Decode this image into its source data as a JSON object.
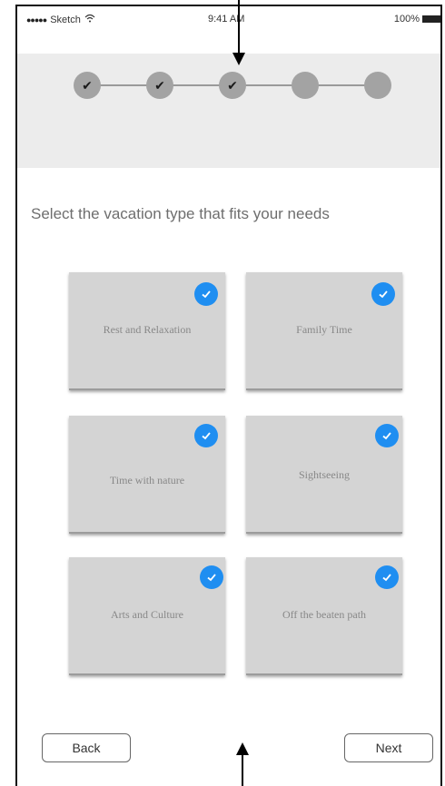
{
  "status_bar": {
    "carrier": "Sketch",
    "signal": "●●●●●",
    "time": "9:41 AM",
    "battery": "100%"
  },
  "stepper": {
    "steps": [
      {
        "state": "completed",
        "glyph": "✔"
      },
      {
        "state": "completed",
        "glyph": "✔"
      },
      {
        "state": "completed",
        "glyph": "✔"
      },
      {
        "state": "pending",
        "glyph": ""
      },
      {
        "state": "pending",
        "glyph": ""
      }
    ]
  },
  "heading": "Select the vacation type that  fits your needs",
  "options": [
    {
      "label": "Rest  and Relaxation",
      "selected": true
    },
    {
      "label": "Family Time",
      "selected": true
    },
    {
      "label": "Time with nature",
      "selected": true
    },
    {
      "label": "Sightseeing",
      "selected": true
    },
    {
      "label": "Arts and Culture",
      "selected": true
    },
    {
      "label": "Off the beaten path",
      "selected": true
    }
  ],
  "navigation": {
    "back_label": "Back",
    "next_label": "Next"
  },
  "colors": {
    "accent": "#1f8ef1",
    "card": "#d4d4d4",
    "band": "#ececec"
  }
}
